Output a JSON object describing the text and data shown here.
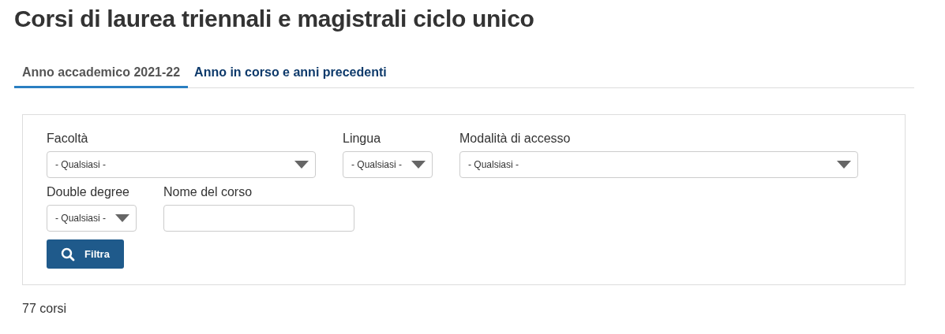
{
  "title": "Corsi di laurea triennali e magistrali ciclo unico",
  "tabs": [
    {
      "label": "Anno accademico 2021-22",
      "selected": true
    },
    {
      "label": "Anno in corso e anni precedenti",
      "selected": false
    }
  ],
  "filters": [
    {
      "kind": "select",
      "label": "Facoltà",
      "value": "- Qualsiasi -"
    },
    {
      "kind": "select",
      "label": "Lingua",
      "value": "- Qualsiasi -"
    },
    {
      "kind": "select",
      "label": "Modalità di accesso",
      "value": "- Qualsiasi -"
    },
    {
      "kind": "select",
      "label": "Double degree",
      "value": "- Qualsiasi -"
    },
    {
      "kind": "text",
      "label": "Nome del corso"
    }
  ],
  "filter_button": "Filtra",
  "result_count": "77 corsi"
}
